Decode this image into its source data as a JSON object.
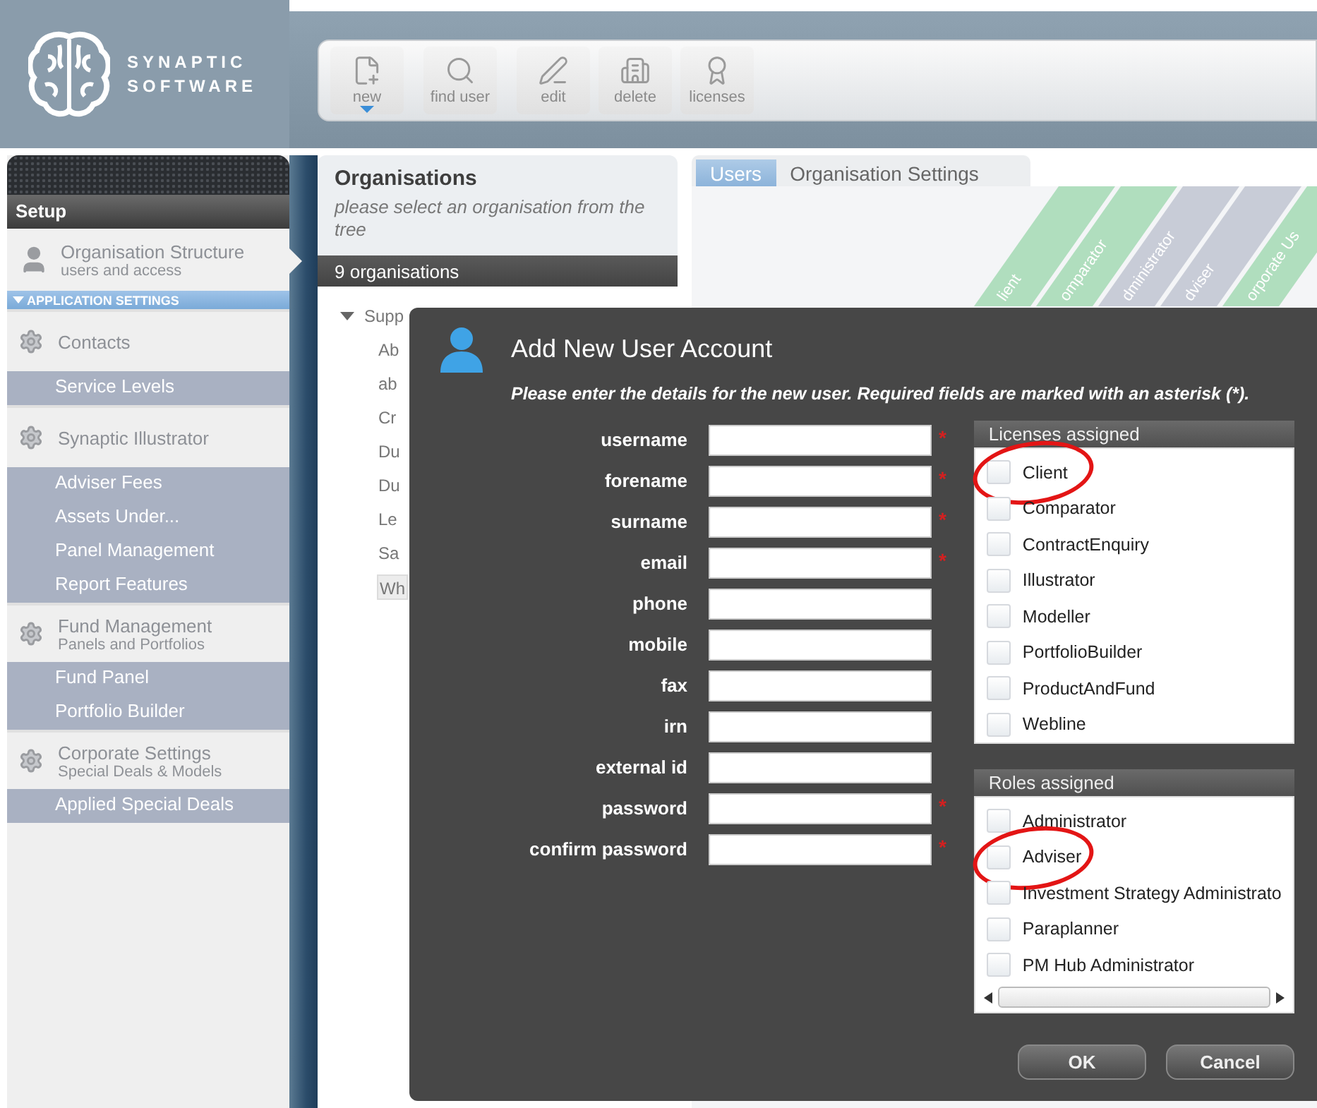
{
  "logo": {
    "line_1": "SYNAPTIC",
    "line_2": "SOFTWARE"
  },
  "toolbar": [
    {
      "label": "new",
      "menu": true
    },
    {
      "label": "find user",
      "menu": false
    },
    {
      "label": "edit",
      "menu": false
    },
    {
      "label": "delete",
      "menu": false
    },
    {
      "label": "licenses",
      "menu": false
    }
  ],
  "sidebar": {
    "title": "Setup",
    "items": [
      {
        "kind": "current",
        "label": "Organisation Structure",
        "subtitle": "users and access",
        "selected": true
      },
      {
        "kind": "category",
        "label": "APPLICATION SETTINGS"
      },
      {
        "kind": "section",
        "label": "Contacts"
      },
      {
        "kind": "sub",
        "label": "Service Levels"
      },
      {
        "kind": "section",
        "label": "Synaptic Illustrator"
      },
      {
        "kind": "sub",
        "label": "Adviser Fees"
      },
      {
        "kind": "sub",
        "label": "Assets Under..."
      },
      {
        "kind": "sub",
        "label": "Panel Management"
      },
      {
        "kind": "sub",
        "label": "Report Features"
      },
      {
        "kind": "section",
        "label": "Fund Management",
        "subtitle": "Panels and Portfolios"
      },
      {
        "kind": "sub",
        "label": "Fund Panel"
      },
      {
        "kind": "sub",
        "label": "Portfolio Builder"
      },
      {
        "kind": "section",
        "label": "Corporate Settings",
        "subtitle": "Special Deals & Models"
      },
      {
        "kind": "sub",
        "label": "Applied Special Deals"
      }
    ]
  },
  "organisations": {
    "title": "Organisations",
    "hint": "please select an organisation from the tree",
    "count": "9 organisations",
    "tree": [
      {
        "label": "Supp",
        "expanded": true,
        "selected": false,
        "children": [
          {
            "label": "Ab",
            "selected": false
          },
          {
            "label": "ab",
            "selected": false
          },
          {
            "label": "Cr",
            "selected": false
          },
          {
            "label": "Du",
            "selected": false
          },
          {
            "label": "Du",
            "selected": false
          },
          {
            "label": "Le",
            "selected": false
          },
          {
            "label": "Sa",
            "selected": false
          },
          {
            "label": "Wh",
            "selected": true
          }
        ]
      }
    ]
  },
  "tabs": [
    {
      "label": "Users",
      "selected": true
    },
    {
      "label": "Organisation Settings",
      "selected": false
    }
  ],
  "users_columns": [
    {
      "label": "lient",
      "kind": "license"
    },
    {
      "label": "omparator",
      "kind": "license"
    },
    {
      "label": "dministrator",
      "kind": "role"
    },
    {
      "label": "dviser",
      "kind": "role"
    },
    {
      "label": "orporate Us",
      "kind": "license"
    }
  ],
  "dialog": {
    "title": "Add New User Account",
    "instructions": "Please enter the details for the new user. Required fields are marked with an asterisk (*).",
    "fields": [
      {
        "label": "username",
        "required": true
      },
      {
        "label": "forename",
        "required": true
      },
      {
        "label": "surname",
        "required": true
      },
      {
        "label": "email",
        "required": true
      },
      {
        "label": "phone",
        "required": false
      },
      {
        "label": "mobile",
        "required": false
      },
      {
        "label": "fax",
        "required": false
      },
      {
        "label": "irn",
        "required": false
      },
      {
        "label": "external id",
        "required": false
      },
      {
        "label": "password",
        "required": true
      },
      {
        "label": "confirm password",
        "required": true
      }
    ],
    "required_mark": "*",
    "licenses": {
      "title": "Licenses assigned",
      "items": [
        {
          "label": "Client",
          "checked": false,
          "circled": true
        },
        {
          "label": "Comparator",
          "checked": false,
          "circled": false
        },
        {
          "label": "ContractEnquiry",
          "checked": false,
          "circled": false
        },
        {
          "label": "Illustrator",
          "checked": false,
          "circled": false
        },
        {
          "label": "Modeller",
          "checked": false,
          "circled": false
        },
        {
          "label": "PortfolioBuilder",
          "checked": false,
          "circled": false
        },
        {
          "label": "ProductAndFund",
          "checked": false,
          "circled": false
        },
        {
          "label": "Webline",
          "checked": false,
          "circled": false
        }
      ]
    },
    "roles": {
      "title": "Roles assigned",
      "items": [
        {
          "label": "Administrator",
          "checked": false,
          "circled": false
        },
        {
          "label": "Adviser",
          "checked": false,
          "circled": true
        },
        {
          "label": "Investment Strategy Administrato",
          "checked": false,
          "circled": false
        },
        {
          "label": "Paraplanner",
          "checked": false,
          "circled": false
        },
        {
          "label": "PM Hub Administrator",
          "checked": false,
          "circled": false
        }
      ]
    },
    "buttons": [
      "OK",
      "Cancel"
    ]
  }
}
